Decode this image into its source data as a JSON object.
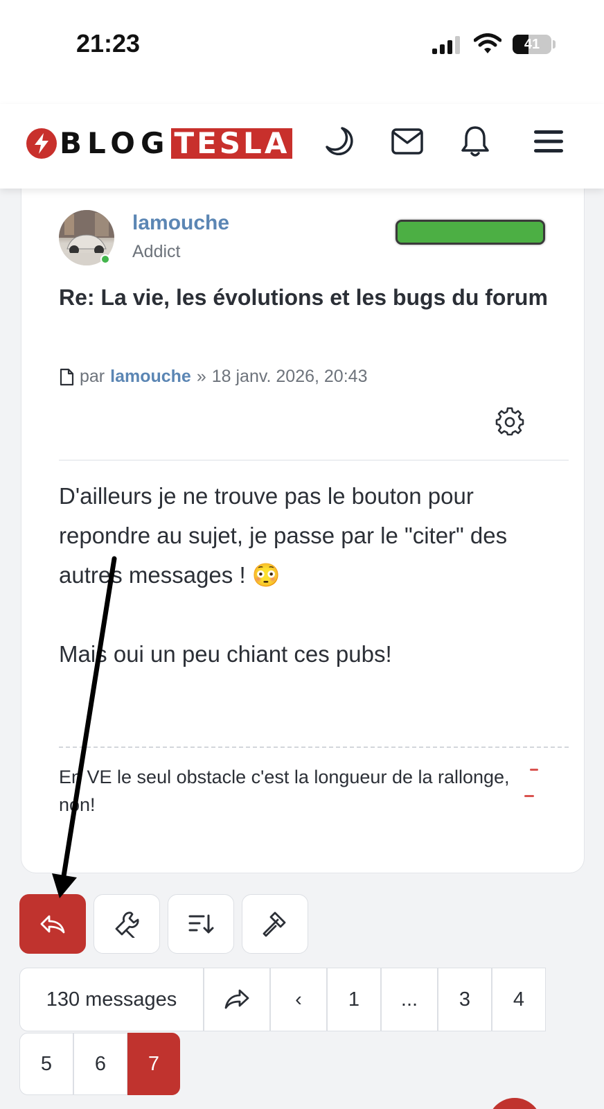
{
  "status_bar": {
    "time": "21:23",
    "battery": "41",
    "battery_level": 0.41
  },
  "header": {
    "logo": {
      "part1": "BLOG",
      "part2": "TESLA"
    },
    "icons": [
      "moon-icon",
      "mail-icon",
      "bell-icon",
      "menu-icon"
    ]
  },
  "post": {
    "author": "lamouche",
    "rank": "Addict",
    "online": true,
    "reputation_fill": 1.0,
    "title": "Re: La vie, les évolutions et les bugs du forum",
    "meta": {
      "prefix": "par",
      "author": "lamouche",
      "sep": "»",
      "date": "18 janv. 2026, 20:43"
    },
    "body": [
      "D'ailleurs je ne trouve pas le bouton pour repondre au sujet, je passe par le \"citer\" des autres messages ! 😳",
      "Mais oui un peu chiant ces pubs!"
    ],
    "signature": "En VE le seul obstacle c'est la longueur de la rallonge, non!"
  },
  "actions": [
    "reply-icon",
    "tools-icon",
    "sort-icon",
    "gavel-icon"
  ],
  "pagination": {
    "count": "130 messages",
    "prev": "‹",
    "pages": [
      "1",
      "...",
      "3",
      "4",
      "5",
      "6",
      "7"
    ],
    "current": "7"
  },
  "colors": {
    "brand_red": "#c0332e",
    "link_blue": "#5b86b4",
    "online_green": "#43b54c"
  }
}
